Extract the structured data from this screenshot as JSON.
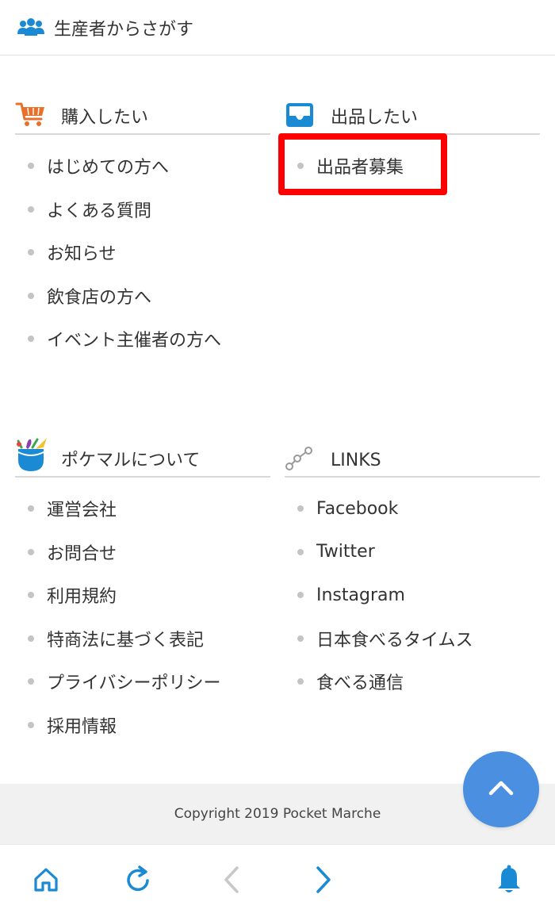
{
  "top_link": {
    "label": "生産者からさがす",
    "icon": "people-group-icon"
  },
  "sections": {
    "buy": {
      "title": "購入したい",
      "icon": "shopping-cart-icon",
      "items": [
        "はじめての方へ",
        "よくある質問",
        "お知らせ",
        "飲食店の方へ",
        "イベント主催者の方へ"
      ]
    },
    "sell": {
      "title": "出品したい",
      "icon": "inbox-tray-icon",
      "items": [
        "出品者募集"
      ]
    },
    "about": {
      "title": "ポケマルについて",
      "icon": "pocket-vegetables-logo-icon",
      "items": [
        "運営会社",
        "お問合せ",
        "利用規約",
        "特商法に基づく表記",
        "プライバシーポリシー",
        "採用情報"
      ]
    },
    "links": {
      "title": "LINKS",
      "icon": "connected-nodes-icon",
      "items": [
        "Facebook",
        "Twitter",
        "Instagram",
        "日本食べるタイムス",
        "食べる通信"
      ]
    }
  },
  "footer": {
    "copyright": "Copyright 2019 Pocket Marche"
  },
  "scroll_top": {
    "icon": "chevron-up-icon"
  },
  "bottom_nav": [
    "home-icon",
    "refresh-icon",
    "back-arrow-icon",
    "forward-arrow-icon",
    "bell-icon"
  ],
  "colors": {
    "accent_blue": "#1a8ad4",
    "cart_orange": "#e8702a",
    "scroll_button": "#4a8fe0",
    "highlight_red": "#ff0000",
    "disabled_gray": "#c8c8c8"
  }
}
